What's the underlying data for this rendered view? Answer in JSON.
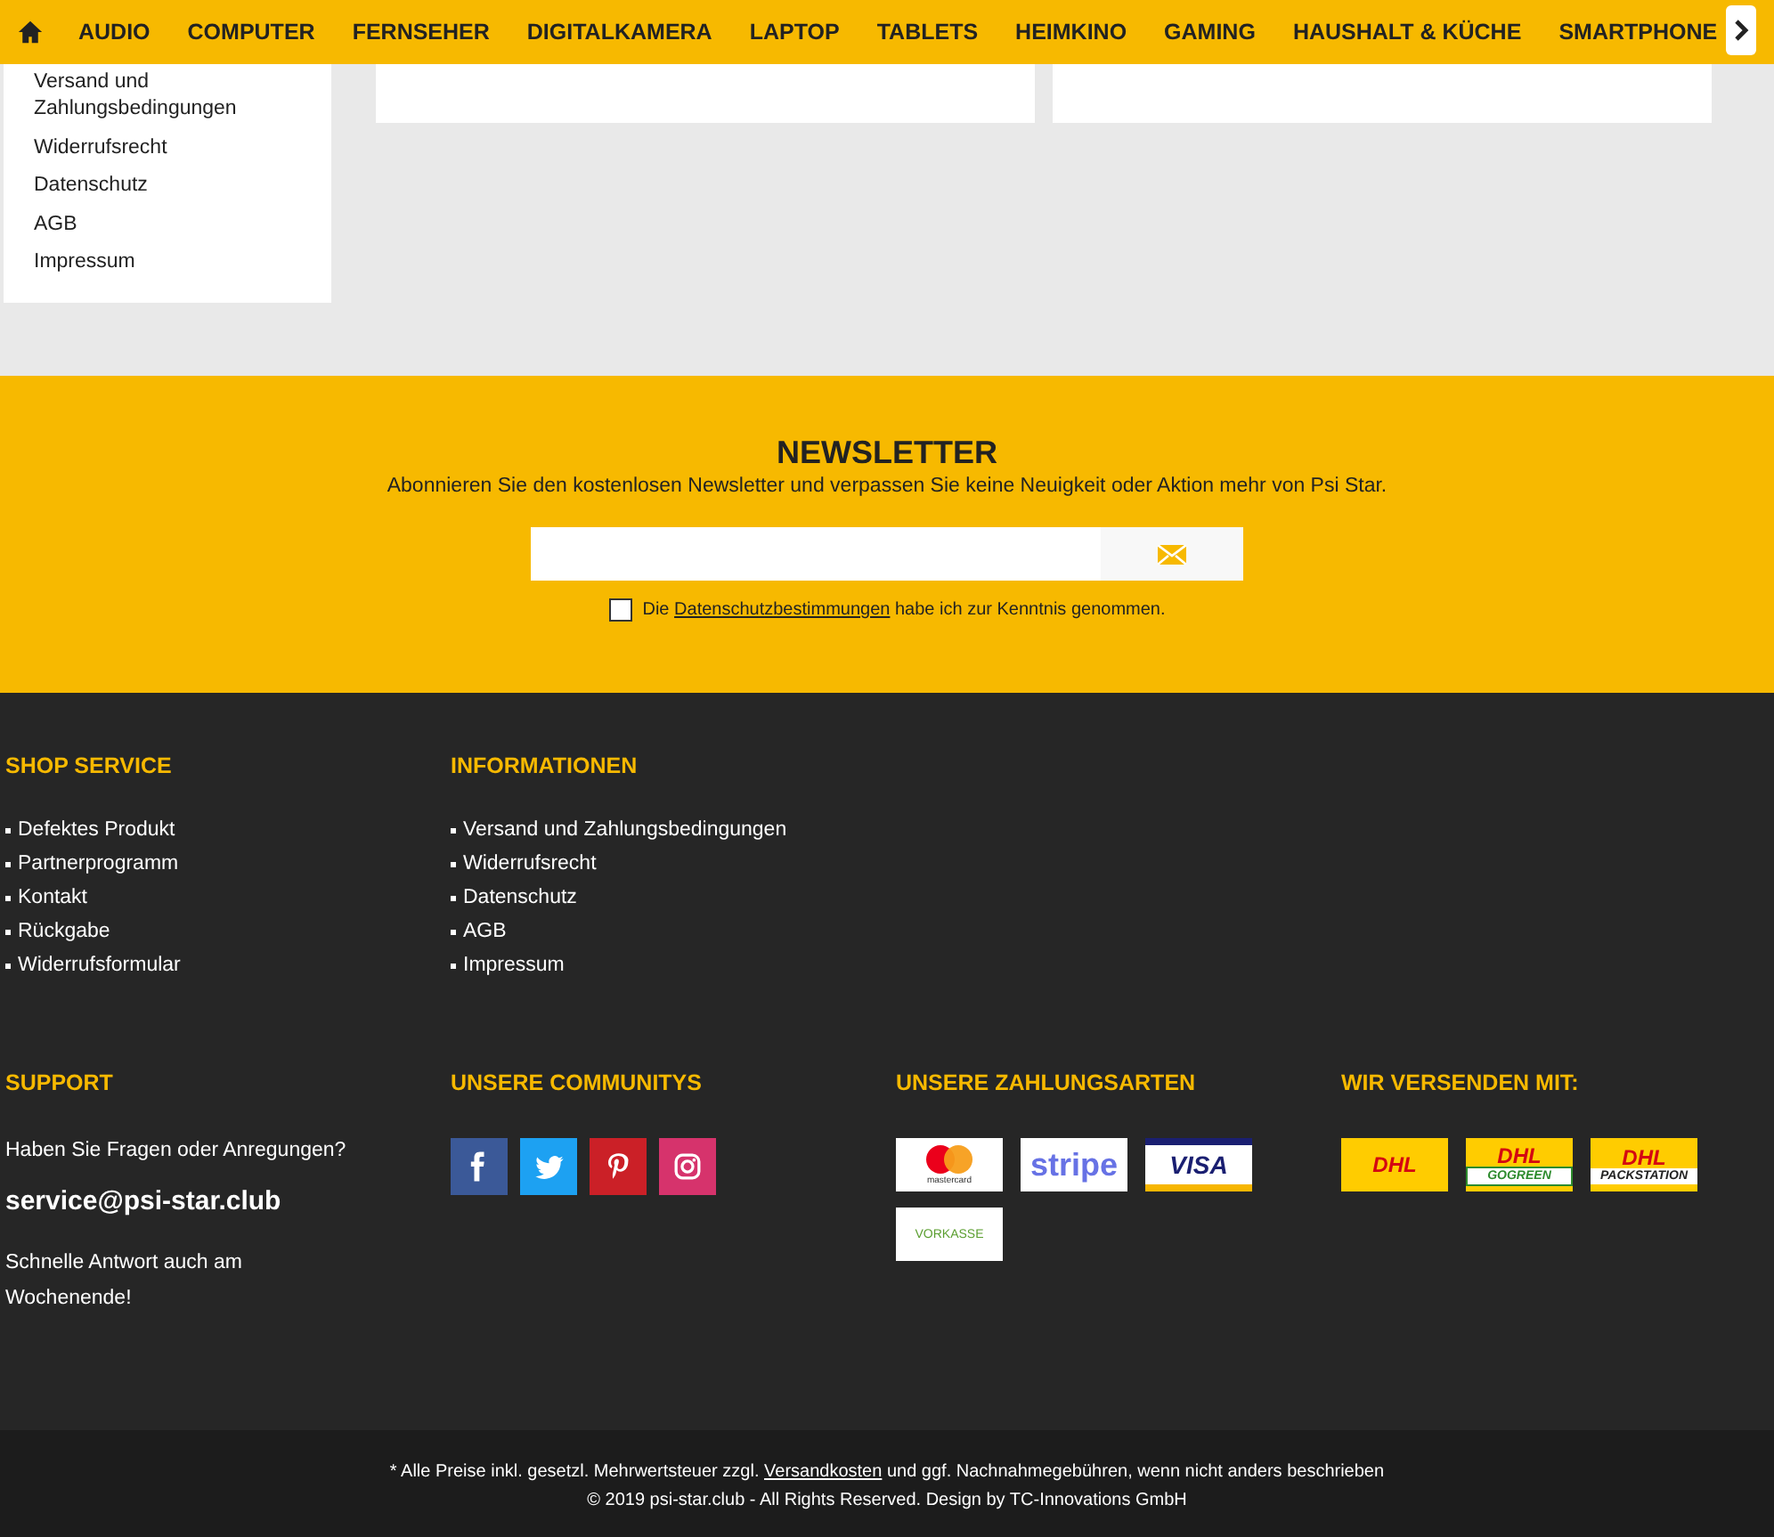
{
  "nav": {
    "items": [
      "AUDIO",
      "COMPUTER",
      "FERNSEHER",
      "DIGITALKAMERA",
      "LAPTOP",
      "TABLETS",
      "HEIMKINO",
      "GAMING",
      "HAUSHALT & KÜCHE",
      "SMARTPHONE"
    ]
  },
  "sidebar": {
    "links": [
      "Versand und Zahlungsbedingungen",
      "Widerrufsrecht",
      "Datenschutz",
      "AGB",
      "Impressum"
    ]
  },
  "newsletter": {
    "title": "NEWSLETTER",
    "text": "Abonnieren Sie den kostenlosen Newsletter und verpassen Sie keine Neuigkeit oder Aktion mehr von Psi Star.",
    "consent": {
      "checked": false,
      "before": "Die ",
      "link": "Datenschutzbestimmungen",
      "after": " habe ich zur Kenntnis genommen."
    }
  },
  "footer": {
    "rows": [
      [
        {
          "kind": "links",
          "title": "SHOP SERVICE",
          "links": [
            "Defektes Produkt",
            "Partnerprogramm",
            "Kontakt",
            "Rückgabe",
            "Widerrufsformular"
          ]
        },
        {
          "kind": "links",
          "title": "INFORMATIONEN",
          "links": [
            "Versand und Zahlungsbedingungen",
            "Widerrufsrecht",
            "Datenschutz",
            "AGB",
            "Impressum"
          ]
        }
      ],
      [
        {
          "kind": "contact",
          "title": "SUPPORT",
          "question": "Haben Sie Fragen oder Anregungen?",
          "email": "service@psi-star.club",
          "note": "Schnelle Antwort auch am Wochenende!"
        },
        {
          "kind": "social",
          "title": "UNSERE COMMUNITYS",
          "items": [
            {
              "kind": "facebook"
            },
            {
              "kind": "twitter"
            },
            {
              "kind": "pinterest"
            },
            {
              "kind": "instagram"
            }
          ]
        },
        {
          "kind": "badges",
          "title": "UNSERE ZAHLUNGSARTEN",
          "badges": [
            {
              "kind": "mastercard",
              "label": "mastercard"
            },
            {
              "kind": "stripe",
              "label": "stripe"
            },
            {
              "kind": "visa",
              "label": "VISA"
            },
            {
              "kind": "vorkasse",
              "label": "VORKASSE"
            }
          ]
        },
        {
          "kind": "badges",
          "title": "WIR VERSENDEN MIT:",
          "badges": [
            {
              "kind": "dhl",
              "label": "DHL"
            },
            {
              "kind": "gogreen",
              "label": "DHL",
              "sub": "GOGREEN"
            },
            {
              "kind": "packstation",
              "label": "DHL",
              "sub": "PACKSTATION"
            }
          ]
        }
      ]
    ]
  },
  "bottom": {
    "legal": {
      "before": "* Alle Preise inkl. gesetzl. Mehrwertsteuer zzgl. ",
      "link": "Versandkosten",
      "after": " und ggf. Nachnahmegebühren, wenn nicht anders beschrieben"
    },
    "copyright": "© 2019 psi-star.club - All Rights Reserved. Design by TC-Innovations GmbH"
  }
}
